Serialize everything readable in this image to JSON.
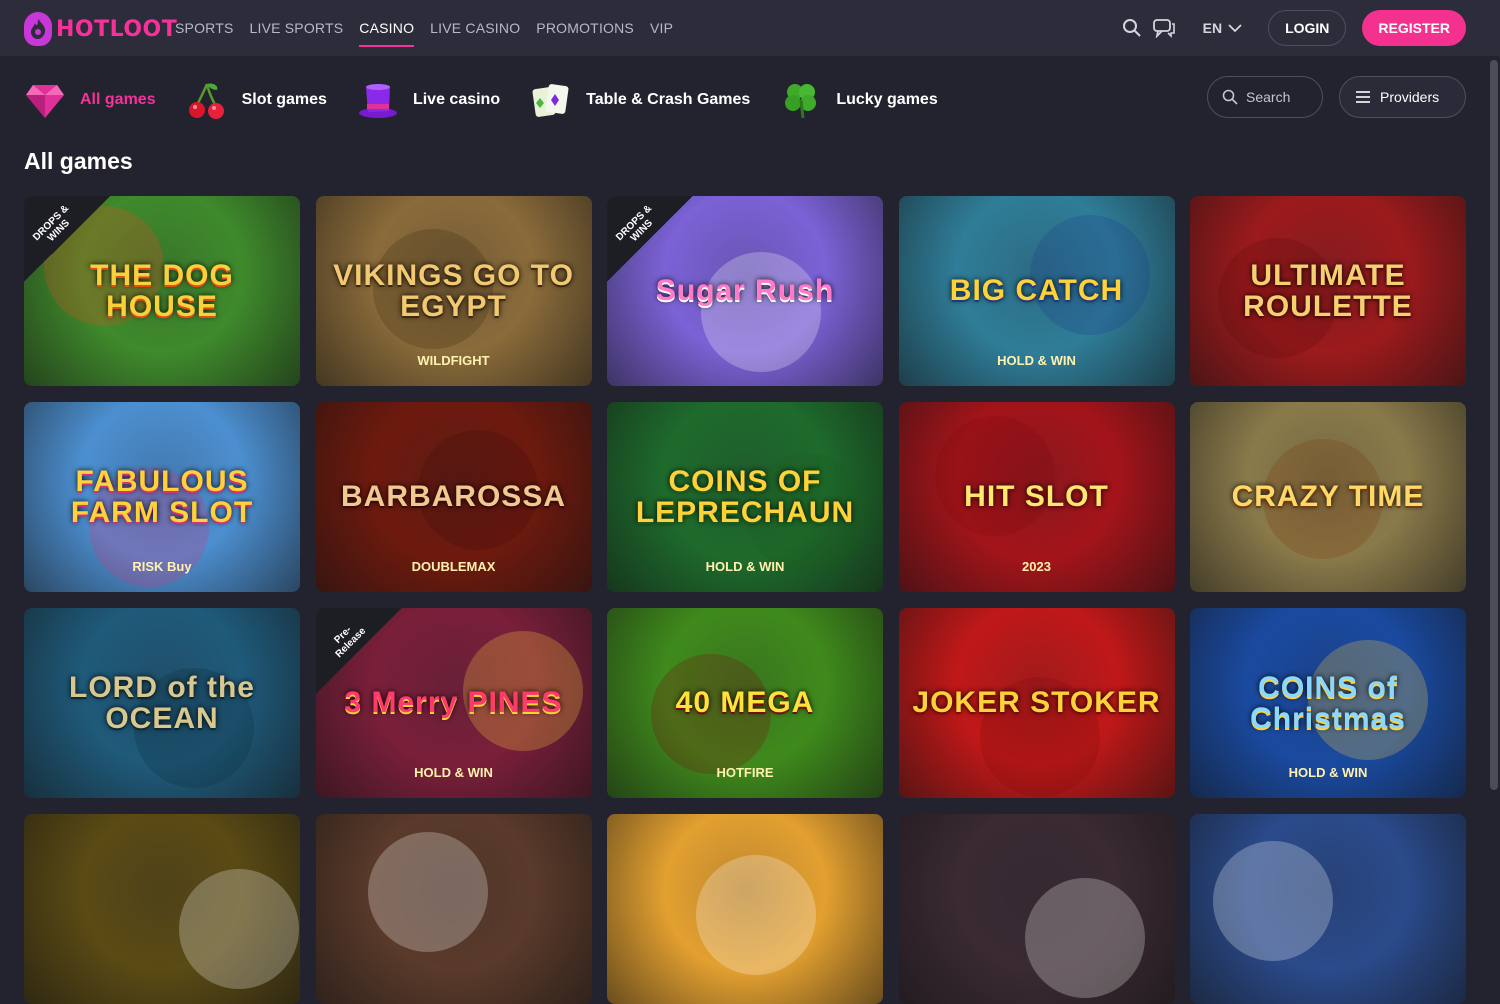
{
  "brand": {
    "name": "HOTLOOT",
    "accent": "#f5319a"
  },
  "nav": {
    "items": [
      {
        "label": "SPORTS",
        "active": false
      },
      {
        "label": "LIVE SPORTS",
        "active": false
      },
      {
        "label": "CASINO",
        "active": true
      },
      {
        "label": "LIVE CASINO",
        "active": false
      },
      {
        "label": "PROMOTIONS",
        "active": false
      },
      {
        "label": "VIP",
        "active": false
      }
    ],
    "language": "EN",
    "login_label": "LOGIN",
    "register_label": "REGISTER"
  },
  "categories": [
    {
      "label": "All games",
      "icon": "gem-icon",
      "active": true
    },
    {
      "label": "Slot games",
      "icon": "cherry-icon",
      "active": false
    },
    {
      "label": "Live casino",
      "icon": "top-hat-icon",
      "active": false
    },
    {
      "label": "Table & Crash Games",
      "icon": "cards-icon",
      "active": false
    },
    {
      "label": "Lucky games",
      "icon": "clover-icon",
      "active": false
    }
  ],
  "search": {
    "label": "Search"
  },
  "providers": {
    "label": "Providers"
  },
  "section": {
    "title": "All games"
  },
  "games": [
    {
      "title": "THE DOG HOUSE",
      "badge": "DROPS & WINS",
      "bg": "#3f8a2c"
    },
    {
      "title": "VIKINGS GO TO EGYPT",
      "sub": "WILDFIGHT",
      "bg": "#8a6b3a"
    },
    {
      "title": "Sugar Rush",
      "badge": "DROPS & WINS",
      "bg": "#7b62d6"
    },
    {
      "title": "BIG CATCH",
      "sub": "HOLD & WIN",
      "bg": "#2f7d98"
    },
    {
      "title": "ULTIMATE ROULETTE",
      "bg": "#9c1a1c"
    },
    {
      "title": "FABULOUS FARM SLOT",
      "sub": "RISK Buy",
      "bg": "#4c8fd0"
    },
    {
      "title": "BARBAROSSA",
      "sub": "DOUBLEMAX",
      "bg": "#6e1a0e"
    },
    {
      "title": "COINS OF LEPRECHAUN",
      "sub": "HOLD & WIN",
      "bg": "#1e6b2c"
    },
    {
      "title": "HIT SLOT",
      "sub": "2023",
      "bg": "#a3141a"
    },
    {
      "title": "CRAZY TIME",
      "bg": "#8a7a4a"
    },
    {
      "title": "LORD of the OCEAN",
      "bg": "#1f5a7a"
    },
    {
      "title": "3 Merry PINES",
      "sub": "HOLD & WIN",
      "badge": "Pre-Release",
      "bg": "#7a1f3a"
    },
    {
      "title": "40 MEGA",
      "sub": "HOTFIRE",
      "bg": "#3f8a1c"
    },
    {
      "title": "JOKER STOKER",
      "bg": "#c01818"
    },
    {
      "title": "COINS of Christmas",
      "sub": "HOLD & WIN",
      "bg": "#1a4aa0"
    },
    {
      "title": "",
      "bg": "#5a4a14"
    },
    {
      "title": "",
      "bg": "#5a3a2a"
    },
    {
      "title": "",
      "bg": "#e3a030"
    },
    {
      "title": "",
      "bg": "#3a2a32"
    },
    {
      "title": "",
      "bg": "#2a4a8a"
    }
  ]
}
